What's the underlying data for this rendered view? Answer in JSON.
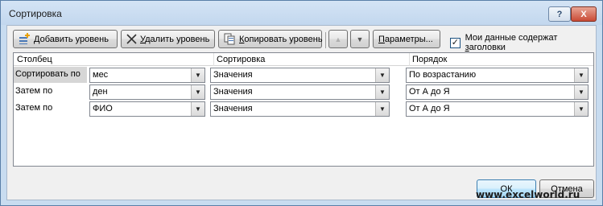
{
  "window": {
    "title": "Сортировка",
    "help": "?",
    "close": "X"
  },
  "toolbar": {
    "add": {
      "pre": "",
      "accel": "Д",
      "post": "обавить уровень"
    },
    "delete": {
      "pre": "",
      "accel": "У",
      "post": "далить уровень"
    },
    "copy": {
      "pre": "",
      "accel": "К",
      "post": "опировать уровень"
    },
    "params": {
      "pre": "",
      "accel": "П",
      "post": "араметры..."
    },
    "header_checkbox": {
      "checked": true,
      "pre": "Мои данные содержат ",
      "accel": "з",
      "post": "аголовки"
    }
  },
  "columns": {
    "column": "Столбец",
    "sort_on": "Сортировка",
    "order": "Порядок"
  },
  "rows": [
    {
      "label": "Сортировать по",
      "column": "мес",
      "sort_on": "Значения",
      "order": "По возрастанию",
      "selected": true
    },
    {
      "label": "Затем по",
      "column": "ден",
      "sort_on": "Значения",
      "order": "От А до Я",
      "selected": false
    },
    {
      "label": "Затем по",
      "column": "ФИО",
      "sort_on": "Значения",
      "order": "От А до Я",
      "selected": false
    }
  ],
  "buttons": {
    "ok": "ОК",
    "cancel": "Отмена"
  },
  "watermark": "www.excelworld.ru",
  "colors": {
    "accent": "#3c7fb1",
    "close": "#c94a35",
    "frame": "#c8dcf0"
  },
  "icons": {
    "add": "add-level-icon",
    "delete": "delete-level-icon",
    "copy": "copy-level-icon",
    "up": "move-up-icon",
    "down": "move-down-icon"
  }
}
